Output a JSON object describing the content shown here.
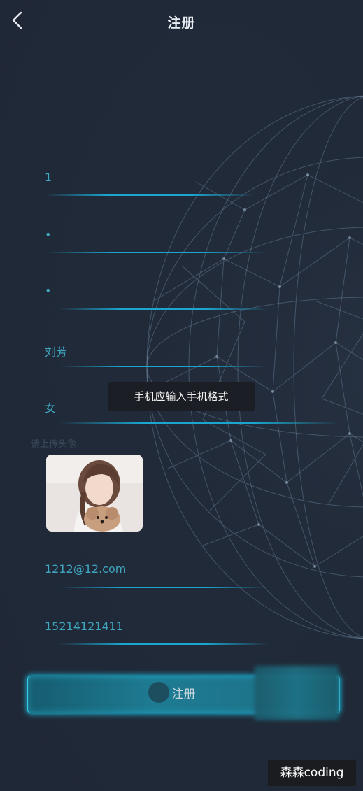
{
  "header": {
    "title": "注册",
    "back_icon": "chevron-left-icon"
  },
  "form": {
    "username": "1",
    "password": "•",
    "confirm_password": "•",
    "name": "刘芳",
    "gender": "女",
    "avatar_label": "请上传头像",
    "email": "1212@12.com",
    "phone": "15214121411"
  },
  "toast": {
    "message": "手机应输入手机格式"
  },
  "submit": {
    "label": "注册"
  },
  "watermark": {
    "text": "森森coding"
  },
  "colors": {
    "background": "#222b3a",
    "accent": "#1aa6cf",
    "field_text": "#3fa6c0"
  }
}
